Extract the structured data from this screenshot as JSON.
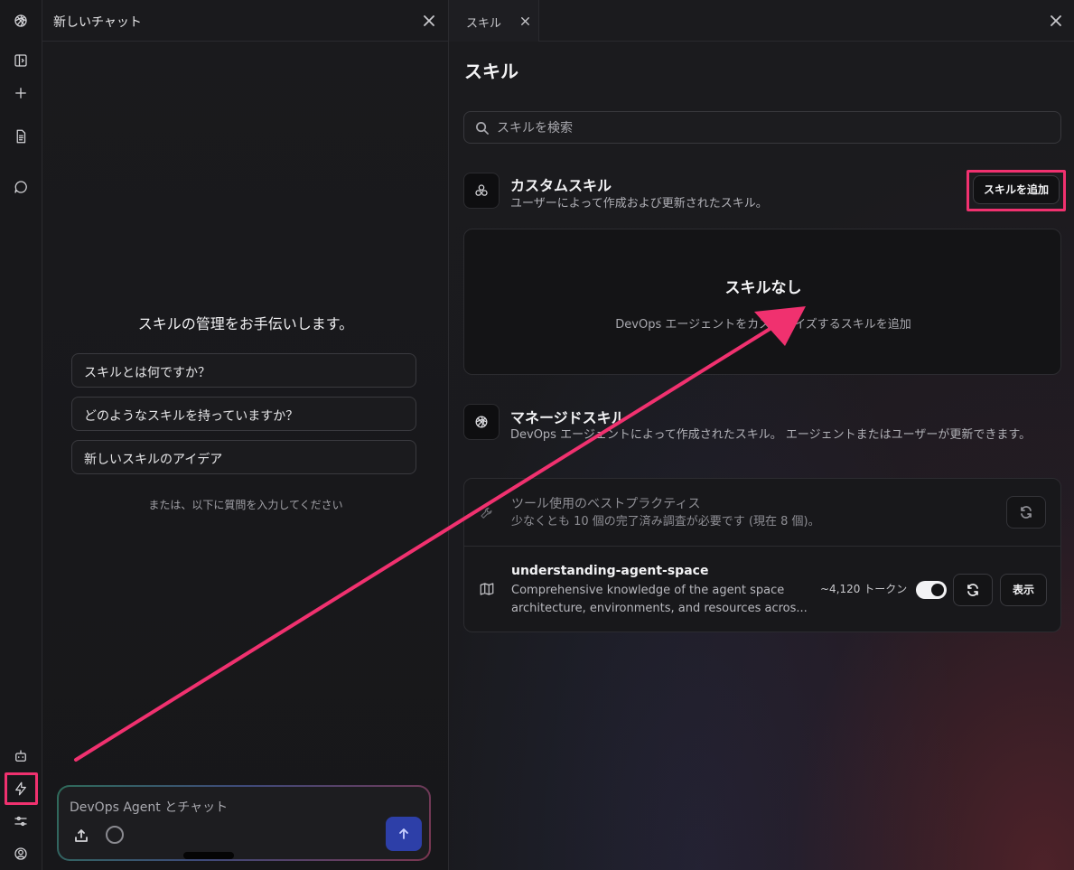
{
  "colors": {
    "highlight": "#f0316f",
    "send_button": "#2d3fa8",
    "background": "#141416"
  },
  "rail": {
    "icons": [
      "logo-icon",
      "sidebar-toggle-icon",
      "plus-icon",
      "document-icon",
      "chat-bubble-icon",
      "robot-icon",
      "lightning-icon",
      "sliders-icon",
      "user-circle-icon"
    ]
  },
  "chat": {
    "title": "新しいチャット",
    "greeting": "スキルの管理をお手伝いします。",
    "suggestions": [
      "スキルとは何ですか？",
      "どのようなスキルを持っていますか？",
      "新しいスキルのアイデア"
    ],
    "or_text": "または、以下に質問を入力してください",
    "input_placeholder": "DevOps Agent とチャット"
  },
  "skills": {
    "tab_label": "スキル",
    "page_title": "スキル",
    "search_placeholder": "スキルを検索",
    "custom": {
      "title": "カスタムスキル",
      "description": "ユーザーによって作成および更新されたスキル。",
      "add_button": "スキルを追加",
      "empty_title": "スキルなし",
      "empty_description": "DevOps エージェントをカスタマイズするスキルを追加"
    },
    "managed": {
      "title": "マネージドスキル",
      "description": "DevOps エージェントによって作成されたスキル。 エージェントまたはユーザーが更新できます。",
      "items": [
        {
          "title": "ツール使用のベストプラクティス",
          "description": "少なくとも 10 個の完了済み調査が必要です (現在 8 個)。",
          "icon": "wrench-icon",
          "disabled": true
        },
        {
          "title": "understanding-agent-space",
          "description": "Comprehensive knowledge of the agent space architecture, environments, and resources acros...",
          "icon": "map-icon",
          "tokens": "~4,120 トークン",
          "enabled": true,
          "view_label": "表示"
        }
      ]
    }
  }
}
